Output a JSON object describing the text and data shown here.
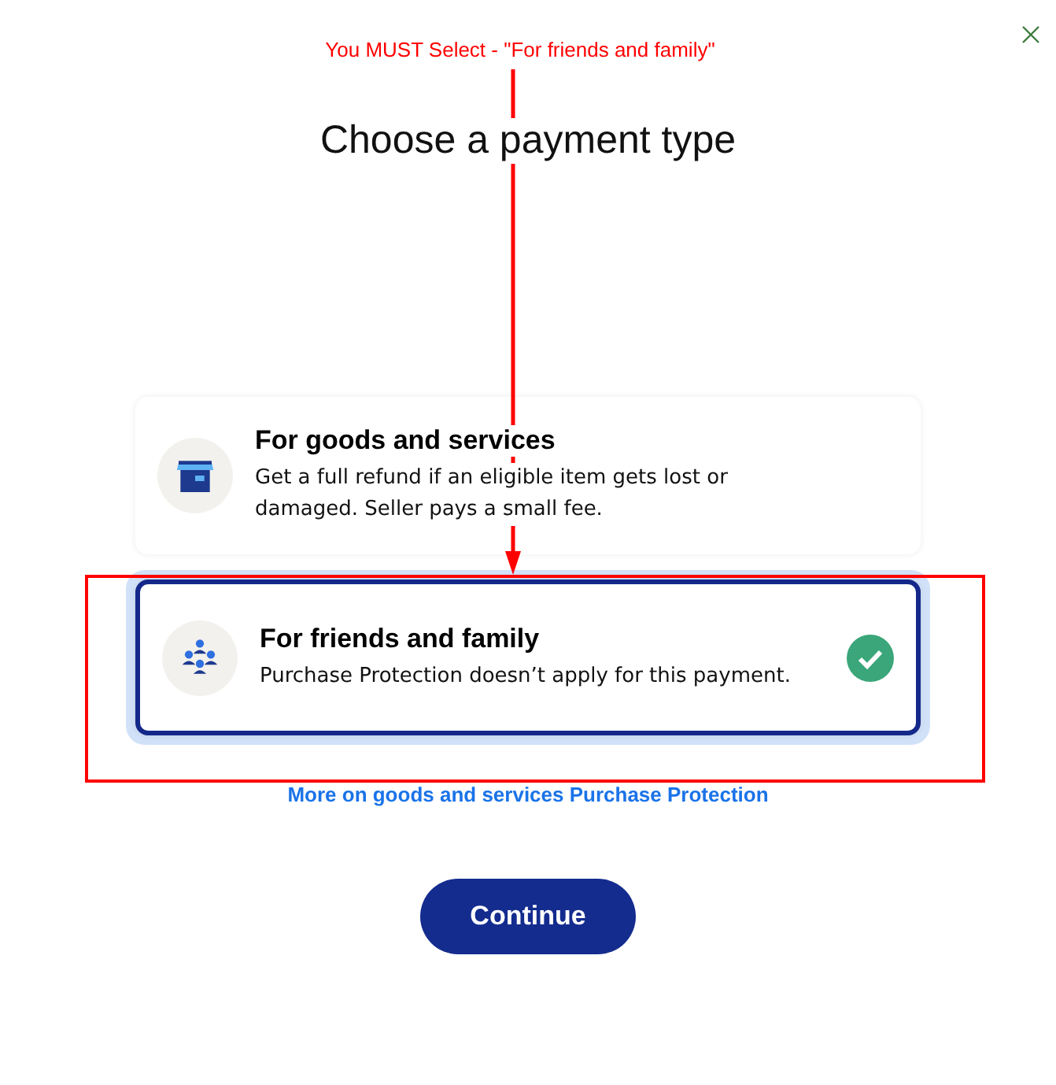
{
  "annotation": {
    "text": "You MUST Select - \"For friends and family\""
  },
  "title": "Choose a payment type",
  "options": [
    {
      "kind": "store",
      "title": "For goods and services",
      "description": "Get a full refund if an eligible item gets lost or damaged. Seller pays a small fee.",
      "selected": false
    },
    {
      "kind": "people",
      "title": "For friends and family",
      "description": "Purchase Protection doesn’t apply for this payment.",
      "selected": true
    }
  ],
  "link": "More on goods and services Purchase Protection",
  "button": "Continue"
}
